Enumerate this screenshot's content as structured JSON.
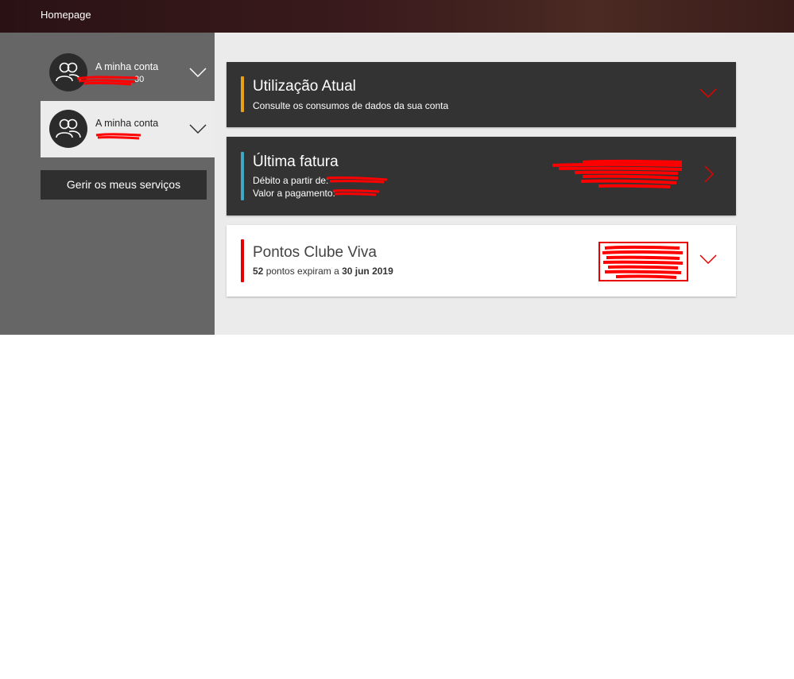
{
  "topbar": {
    "home_label": "Homepage"
  },
  "sidebar": {
    "accounts": [
      {
        "label": "A minha conta",
        "number_visible": "30",
        "selected": false
      },
      {
        "label": "A minha conta",
        "number_visible": "",
        "selected": true
      }
    ],
    "manage_button": "Gerir os meus serviços"
  },
  "cards": {
    "usage": {
      "title": "Utilização Atual",
      "subtitle": "Consulte os consumos de dados da sua conta",
      "accent": "#e8a215"
    },
    "invoice": {
      "title": "Última fatura",
      "debit_label": "Débito a partir de:",
      "payment_label": "Valor a pagamento:",
      "accent": "#3fa7c5"
    },
    "points": {
      "title": "Pontos Clube Viva",
      "points_value": "52",
      "points_text": " pontos expiram a ",
      "expiry_date": "30 jun 2019",
      "accent": "#e60000"
    }
  },
  "colors": {
    "topbar": "#3a1a1c",
    "sidebar": "#666666",
    "main_bg": "#ebebeb",
    "dark_card": "#333333",
    "vodafone_red": "#e60000"
  }
}
